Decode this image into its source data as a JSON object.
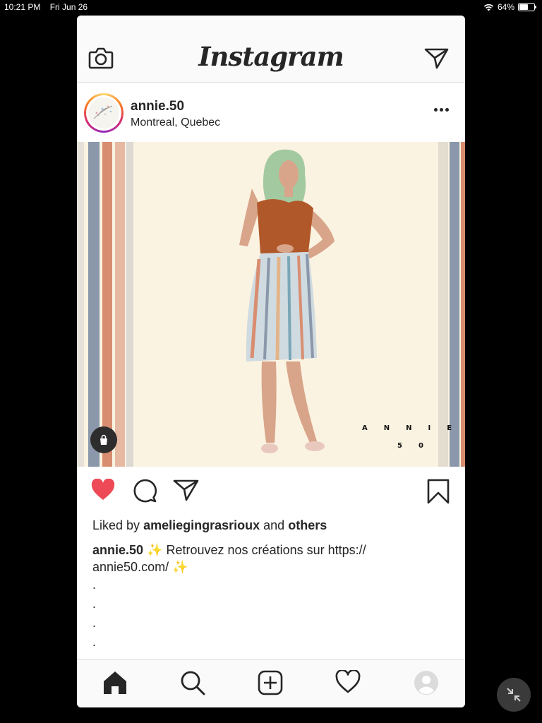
{
  "status_bar": {
    "time": "10:21 PM",
    "date": "Fri Jun 26",
    "battery": "64%",
    "battery_level": 0.64,
    "icons": [
      "wifi-icon",
      "battery-icon"
    ]
  },
  "app": {
    "title": "Instagram",
    "icons": [
      "camera-icon",
      "direct-message-icon"
    ]
  },
  "post": {
    "username": "annie.50",
    "location": "Montreal, Quebec",
    "image_logo_line1": "ANNIE",
    "image_logo_line2": "50",
    "liked": true,
    "likes": {
      "prefix": "Liked by",
      "user": "ameliegingrasrioux",
      "conjunction": "and",
      "others": "others"
    },
    "caption": {
      "username": "annie.50",
      "text": "Retrouvez nos créations sur https:// annie50.com/",
      "emoji": "✨"
    },
    "dots": [
      ".",
      ".",
      ".",
      "."
    ]
  },
  "colors": {
    "like_red": "#ed4956",
    "text": "#262626",
    "border": "#dbdbdb",
    "background": "#000000"
  },
  "tabs": [
    "home",
    "search",
    "new-post",
    "activity",
    "profile"
  ]
}
